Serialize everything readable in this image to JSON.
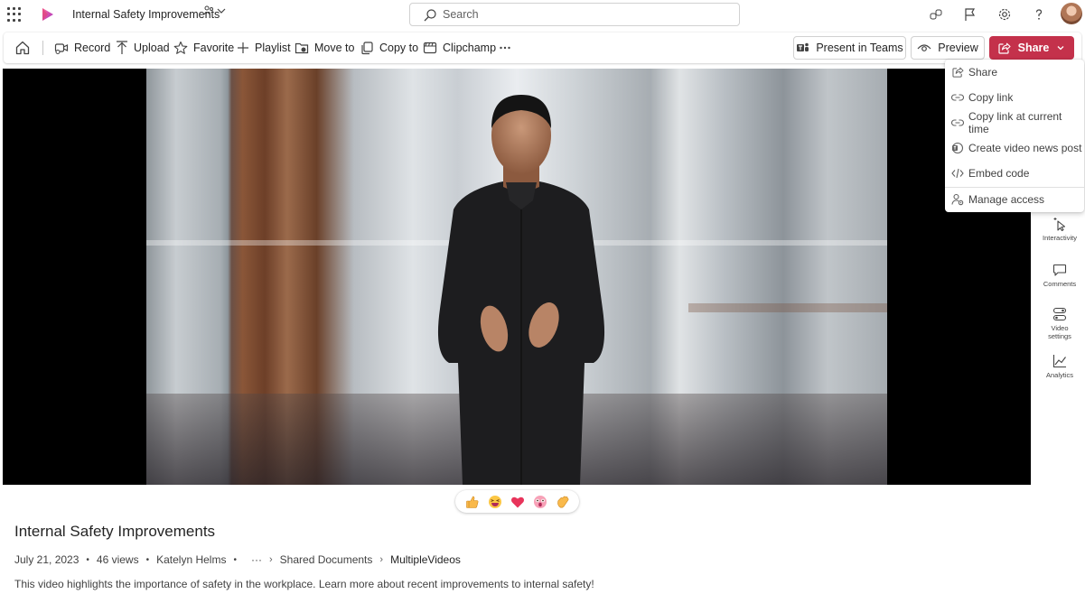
{
  "header": {
    "title": "Internal Safety Improvements",
    "search_placeholder": "Search"
  },
  "toolbar": {
    "record": "Record",
    "upload": "Upload",
    "favorite": "Favorite",
    "playlist": "Playlist",
    "move_to": "Move to",
    "copy_to": "Copy to",
    "clipchamp": "Clipchamp",
    "present_in_teams": "Present in Teams",
    "preview": "Preview",
    "share": "Share"
  },
  "share_menu": {
    "items": [
      {
        "label": "Share",
        "icon": "share-icon"
      },
      {
        "label": "Copy link",
        "icon": "link-icon"
      },
      {
        "label": "Copy link at current time",
        "icon": "link-icon"
      },
      {
        "label": "Create video news post",
        "icon": "news-icon"
      },
      {
        "label": "Embed code",
        "icon": "code-icon"
      },
      {
        "label": "Manage access",
        "icon": "people-settings-icon"
      }
    ]
  },
  "rail": {
    "interactivity": "Interactivity",
    "comments": "Comments",
    "video_settings": "Video settings",
    "analytics": "Analytics"
  },
  "reactions": [
    "thumbs-up",
    "laugh",
    "heart",
    "surprised",
    "clap"
  ],
  "details": {
    "title": "Internal Safety Improvements",
    "date": "July 21, 2023",
    "views": "46 views",
    "author": "Katelyn Helms",
    "more": "···",
    "breadcrumb_1": "Shared Documents",
    "breadcrumb_2": "MultipleVideos",
    "description": "This video highlights the importance of safety in the workplace. Learn more about recent improvements to internal safety!"
  },
  "colors": {
    "brand": "#c4314b",
    "app_logo": "#c239b3"
  }
}
